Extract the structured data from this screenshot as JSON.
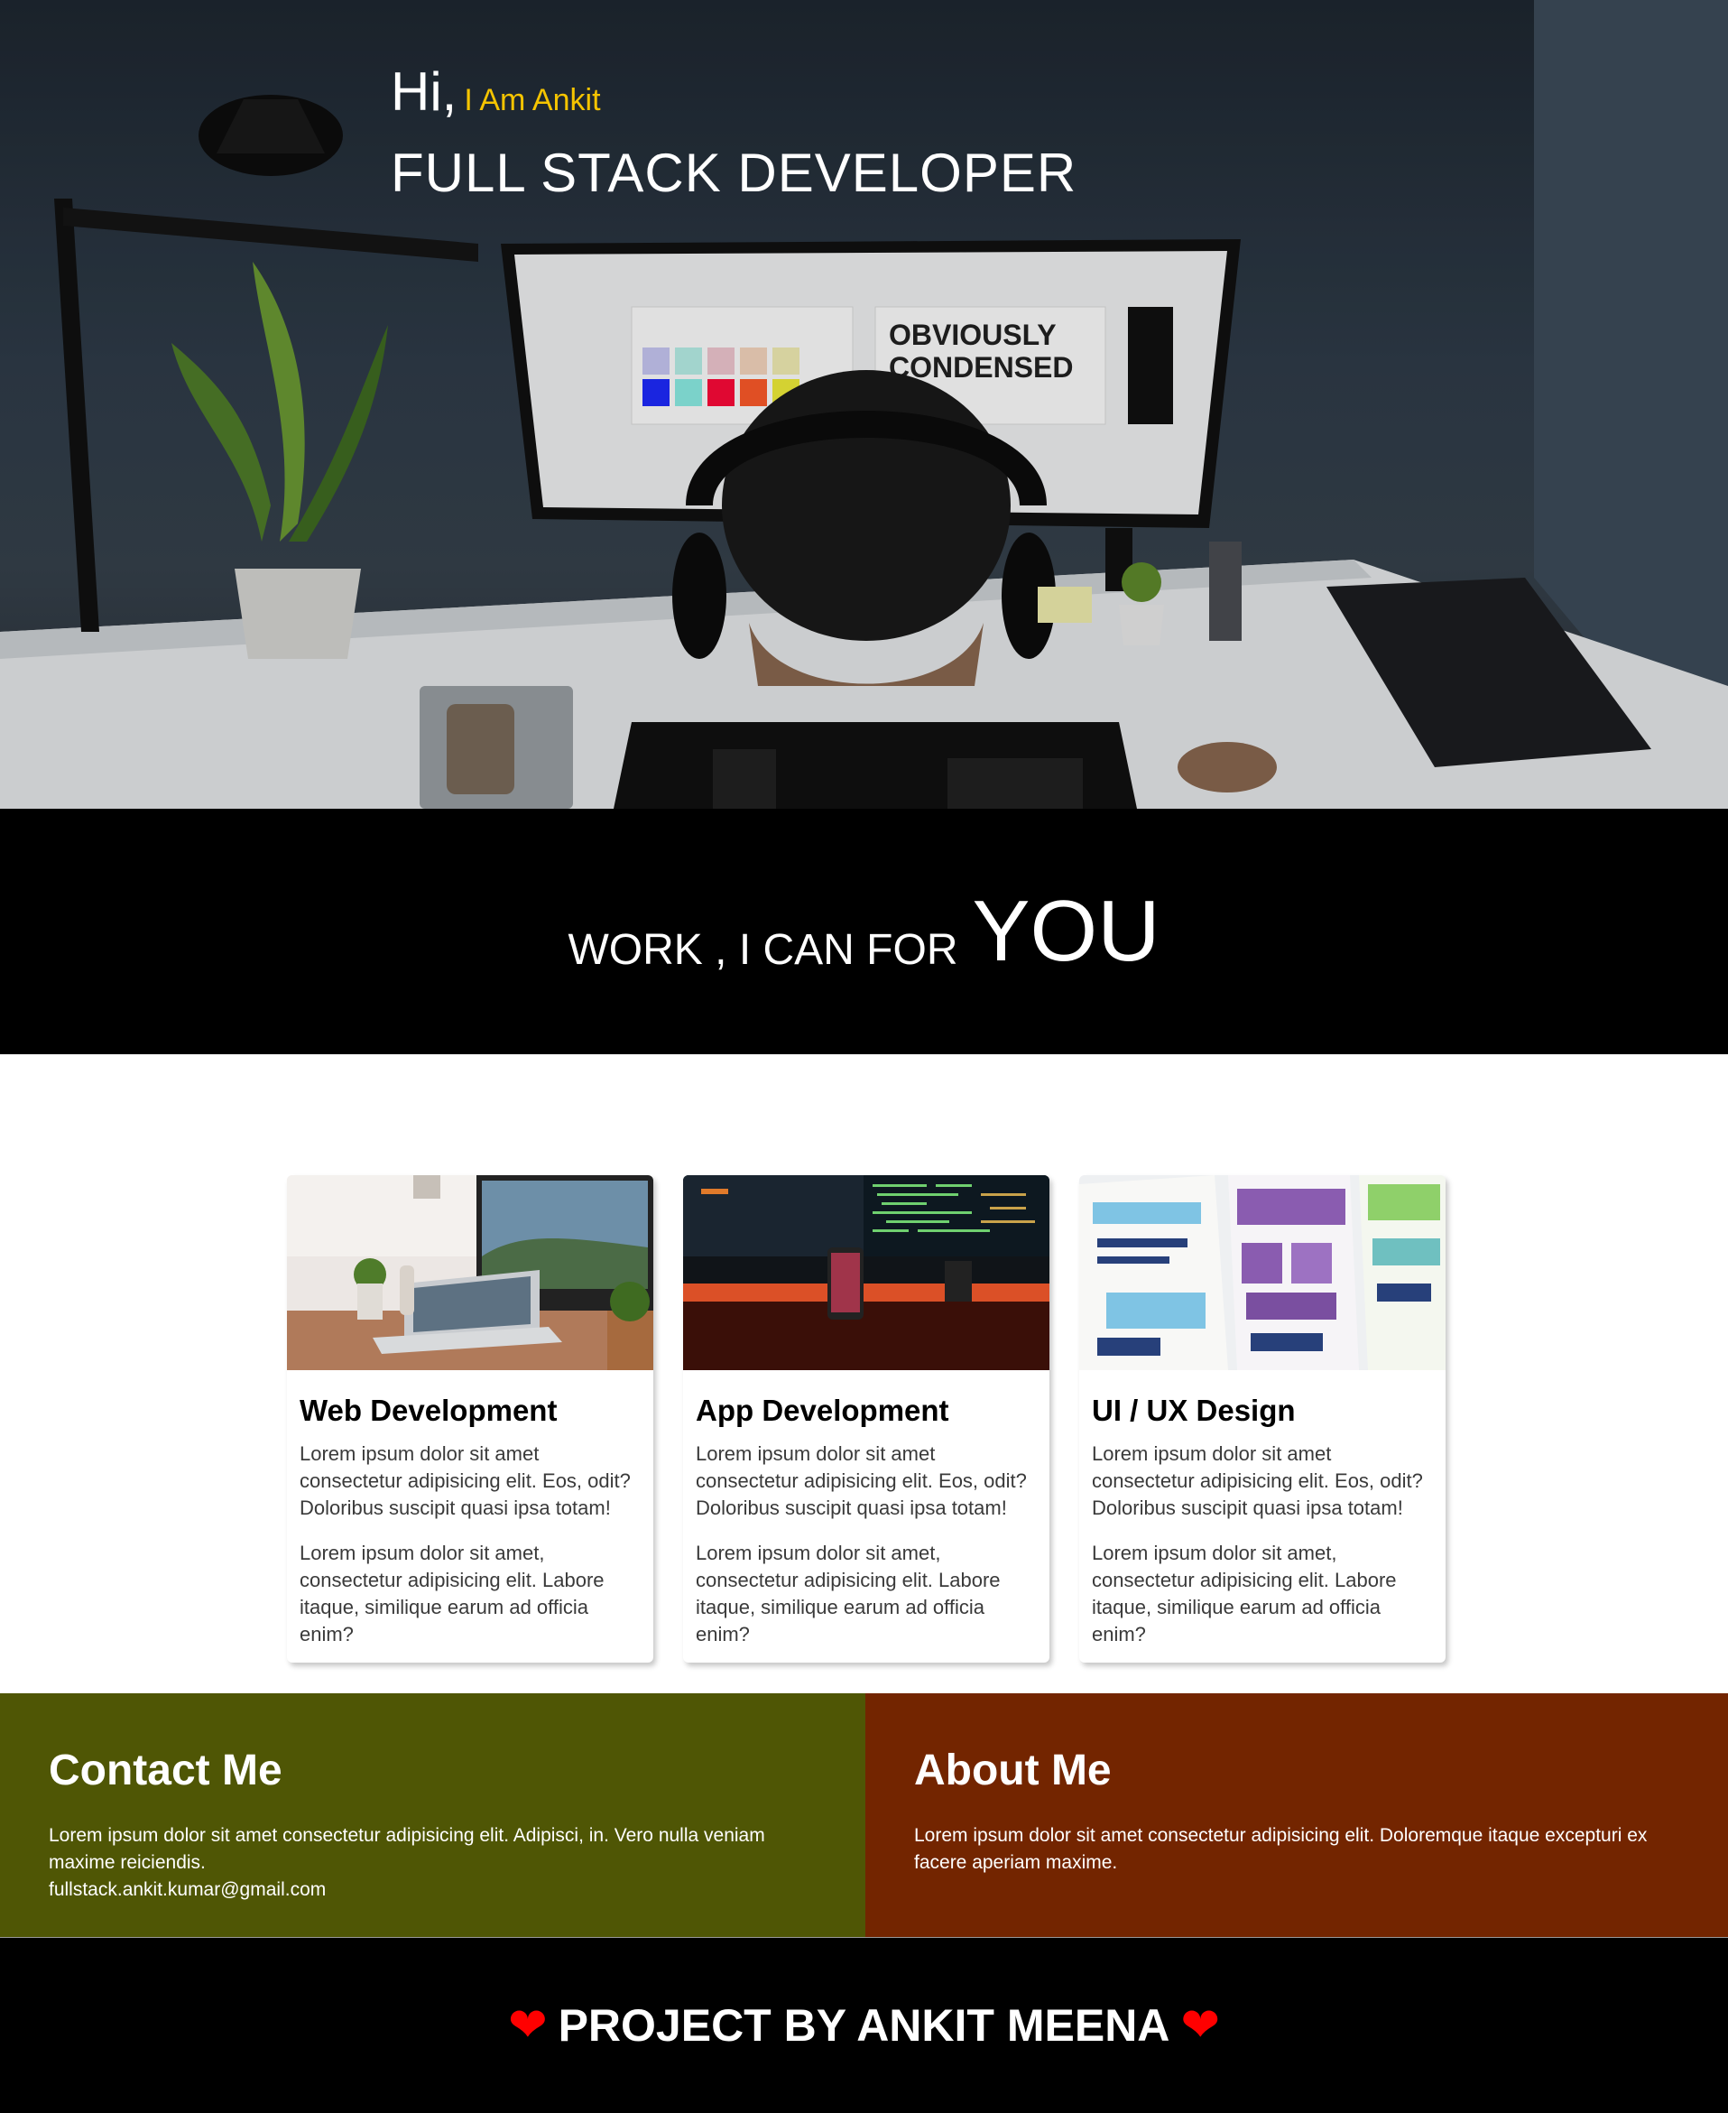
{
  "hero": {
    "greeting": "Hi,",
    "name": "I Am Ankit",
    "role": "FULL STACK DEVELOPER",
    "screen_text": [
      "OBVIOUSLY",
      "CONDENSED"
    ]
  },
  "work_band": {
    "small_text": "WORK , I CAN FOR",
    "big_text": "YOU"
  },
  "cards": [
    {
      "title": "Web Development",
      "text1": "Lorem ipsum dolor sit amet consectetur adipisicing elit. Eos, odit? Doloribus suscipit quasi ipsa totam!",
      "text2": "Lorem ipsum dolor sit amet, consectetur adipisicing elit. Labore itaque, similique earum ad officia enim?"
    },
    {
      "title": "App Development",
      "text1": "Lorem ipsum dolor sit amet consectetur adipisicing elit. Eos, odit? Doloribus suscipit quasi ipsa totam!",
      "text2": "Lorem ipsum dolor sit amet, consectetur adipisicing elit. Labore itaque, similique earum ad officia enim?"
    },
    {
      "title": "UI / UX Design",
      "text1": "Lorem ipsum dolor sit amet consectetur adipisicing elit. Eos, odit? Doloribus suscipit quasi ipsa totam!",
      "text2": "Lorem ipsum dolor sit amet, consectetur adipisicing elit. Labore itaque, similique earum ad officia enim?"
    }
  ],
  "contact": {
    "title": "Contact Me",
    "text": "Lorem ipsum dolor sit amet consectetur adipisicing elit. Adipisci, in. Vero nulla veniam maxime reiciendis.",
    "email": "fullstack.ankit.kumar@gmail.com"
  },
  "about": {
    "title": "About Me",
    "text": "Lorem ipsum dolor sit amet consectetur adipisicing elit. Doloremque itaque excepturi ex facere aperiam maxime."
  },
  "footer": {
    "text": "PROJECT BY ANKIT MEENA",
    "heart": "❤"
  },
  "colors": {
    "accent_yellow": "#f5c400",
    "contact_bg": "#4f5605",
    "about_bg": "#732500",
    "footer_heart": "#ff0000"
  }
}
